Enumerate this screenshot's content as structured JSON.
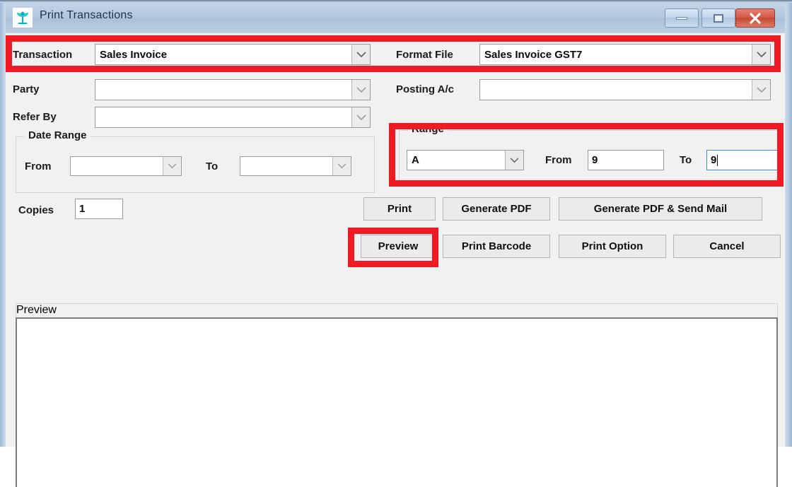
{
  "window": {
    "title": "Print Transactions",
    "icon": "plant-sprout-icon",
    "controls": {
      "minimize": "minimize-icon",
      "maximize": "maximize-icon",
      "close": "close-icon"
    }
  },
  "form": {
    "transaction": {
      "label": "Transaction",
      "value": "Sales Invoice",
      "placeholder": ""
    },
    "format_file": {
      "label": "Format File",
      "value": "Sales Invoice GST7",
      "placeholder": ""
    },
    "party": {
      "label": "Party",
      "value": "",
      "placeholder": ""
    },
    "posting_ac": {
      "label": "Posting A/c",
      "value": "",
      "placeholder": ""
    },
    "refer_by": {
      "label": "Refer By",
      "value": "",
      "placeholder": ""
    },
    "copies": {
      "label": "Copies",
      "value": "1"
    }
  },
  "date_range": {
    "title": "Date Range",
    "from_label": "From",
    "from_value": "",
    "to_label": "To",
    "to_value": ""
  },
  "range": {
    "title": "Range",
    "series_value": "A",
    "from_label": "From",
    "from_value": "9",
    "to_label": "To",
    "to_value": "9",
    "to_focused": true
  },
  "buttons": {
    "print": "Print",
    "generate_pdf": "Generate PDF",
    "generate_pdf_send_mail": "Generate PDF & Send Mail",
    "preview": "Preview",
    "print_barcode": "Print Barcode",
    "print_option": "Print Option",
    "cancel": "Cancel"
  },
  "preview": {
    "title": "Preview",
    "content": ""
  },
  "annotations": {
    "highlight_color": "#ef1a24",
    "regions": [
      "transaction-and-format-file-row",
      "range-groupbox",
      "preview-button"
    ]
  },
  "colors": {
    "titlebar_text": "#18314f",
    "close_button": "#c74734",
    "focus_border": "#3a8fd4",
    "client_background": "#f1f1f1"
  }
}
